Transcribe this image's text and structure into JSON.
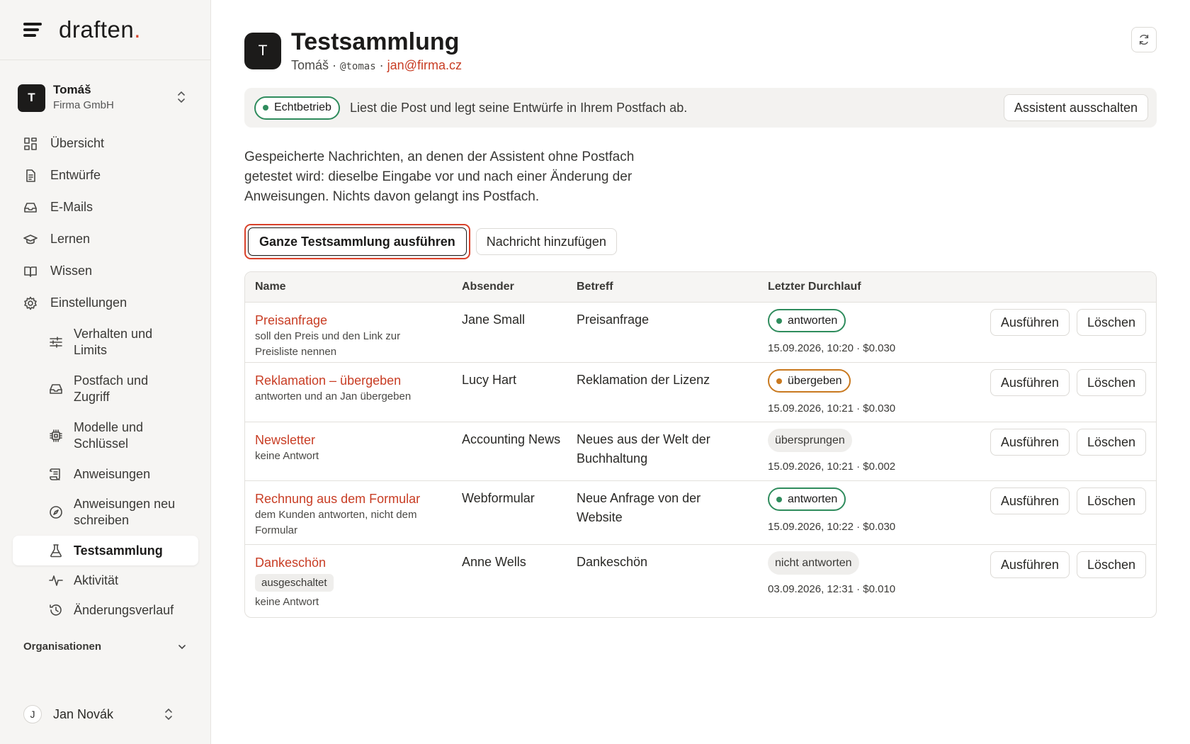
{
  "brand": {
    "logo": "draften",
    "logo_dot": "."
  },
  "account": {
    "initial": "T",
    "name": "Tomáš",
    "company": "Firma GmbH"
  },
  "nav": {
    "items": [
      {
        "label": "Übersicht",
        "icon": "grid-icon"
      },
      {
        "label": "Entwürfe",
        "icon": "document-icon"
      },
      {
        "label": "E-Mails",
        "icon": "inbox-icon"
      },
      {
        "label": "Lernen",
        "icon": "graduation-cap-icon"
      },
      {
        "label": "Wissen",
        "icon": "book-icon"
      },
      {
        "label": "Einstellungen",
        "icon": "gear-icon"
      }
    ],
    "sub_items": [
      {
        "label": "Verhalten und Limits",
        "icon": "sliders-icon"
      },
      {
        "label": "Postfach und Zugriff",
        "icon": "inbox-icon"
      },
      {
        "label": "Modelle und Schlüssel",
        "icon": "chip-icon"
      },
      {
        "label": "Anweisungen",
        "icon": "scroll-icon"
      },
      {
        "label": "Anweisungen neu schreiben",
        "icon": "compass-icon"
      },
      {
        "label": "Testsammlung",
        "icon": "flask-icon",
        "active": true
      },
      {
        "label": "Aktivität",
        "icon": "activity-icon"
      },
      {
        "label": "Änderungsverlauf",
        "icon": "history-icon"
      }
    ],
    "organisations": "Organisationen"
  },
  "user": {
    "initial": "J",
    "name": "Jan Novák"
  },
  "header": {
    "initial": "T",
    "title": "Testsammlung",
    "owner": "Tomáš",
    "sep1": "·",
    "handle": "@tomas",
    "sep2": "·",
    "email": "jan@firma.cz"
  },
  "status": {
    "badge": "Echtbetrieb",
    "text": "Liest die Post und legt seine Entwürfe in Ihrem Postfach ab.",
    "button": "Assistent ausschalten"
  },
  "intro": "Gespeicherte Nachrichten, an denen der Assistent ohne Postfach getestet wird: dieselbe Eingabe vor und nach einer Änderung der Anweisungen. Nichts davon gelangt ins Postfach.",
  "actions": {
    "run_all": "Ganze Testsammlung ausführen",
    "add": "Nachricht hinzufügen"
  },
  "table": {
    "columns": [
      "Name",
      "Absender",
      "Betreff",
      "Letzter Durchlauf"
    ],
    "run_label": "Ausführen",
    "delete_label": "Löschen",
    "rows": [
      {
        "name": "Preisanfrage",
        "desc": "soll den Preis und den Link zur Preisliste nennen",
        "sender": "Jane Small",
        "subject": "Preisanfrage",
        "result": "antworten",
        "result_style": "green",
        "meta": "15.09.2026, 10:20 · $0.030"
      },
      {
        "name": "Reklamation – übergeben",
        "desc": "antworten und an Jan übergeben",
        "sender": "Lucy Hart",
        "subject": "Reklamation der Lizenz",
        "result": "übergeben",
        "result_style": "orange",
        "meta": "15.09.2026, 10:21 · $0.030"
      },
      {
        "name": "Newsletter",
        "desc": "keine Antwort",
        "sender": "Accounting News",
        "subject": "Neues aus der Welt der Buchhaltung",
        "result": "übersprungen",
        "result_style": "gray",
        "meta": "15.09.2026, 10:21 · $0.002"
      },
      {
        "name": "Rechnung aus dem Formular",
        "desc": "dem Kunden antworten, nicht dem Formular",
        "sender": "Webformular",
        "subject": "Neue Anfrage von der Website",
        "result": "antworten",
        "result_style": "green",
        "meta": "15.09.2026, 10:22 · $0.030"
      },
      {
        "name": "Dankeschön",
        "tag": "ausgeschaltet",
        "desc": "keine Antwort",
        "sender": "Anne Wells",
        "subject": "Dankeschön",
        "result": "nicht antworten",
        "result_style": "gray",
        "meta": "03.09.2026, 12:31 · $0.010"
      }
    ]
  },
  "colors": {
    "accent": "#c83d24",
    "green": "#2f8c5d",
    "orange": "#c9791f",
    "highlight": "#d9412a"
  }
}
